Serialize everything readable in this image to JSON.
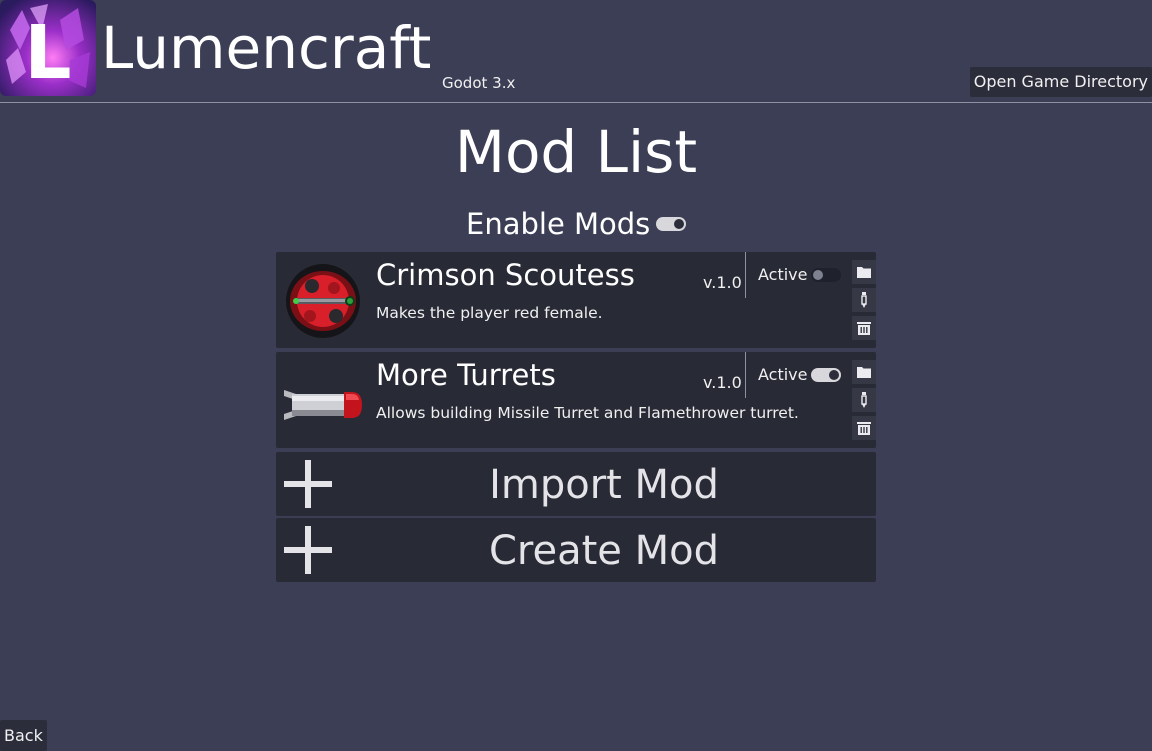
{
  "header": {
    "app_title": "Lumencraft",
    "engine_label": "Godot 3.x",
    "open_dir_label": "Open Game Directory",
    "logo_letter": "L"
  },
  "page_title": "Mod List",
  "enable_mods": {
    "label": "Enable Mods",
    "enabled": true
  },
  "mods": [
    {
      "name": "Crimson Scoutess",
      "description": "Makes the player red female.",
      "version": "v.1.0",
      "active_label": "Active",
      "active": false,
      "icon": "red-mech-icon"
    },
    {
      "name": "More Turrets",
      "description": "Allows building Missile Turret and Flamethrower turret.",
      "version": "v.1.0",
      "active_label": "Active",
      "active": true,
      "icon": "missile-icon"
    }
  ],
  "actions": {
    "import_label": "Import Mod",
    "create_label": "Create Mod"
  },
  "back_label": "Back",
  "colors": {
    "background": "#3b3e55",
    "panel": "#282a36",
    "toggle_on": "#d8d8dc",
    "accent_red": "#d81f2a"
  }
}
